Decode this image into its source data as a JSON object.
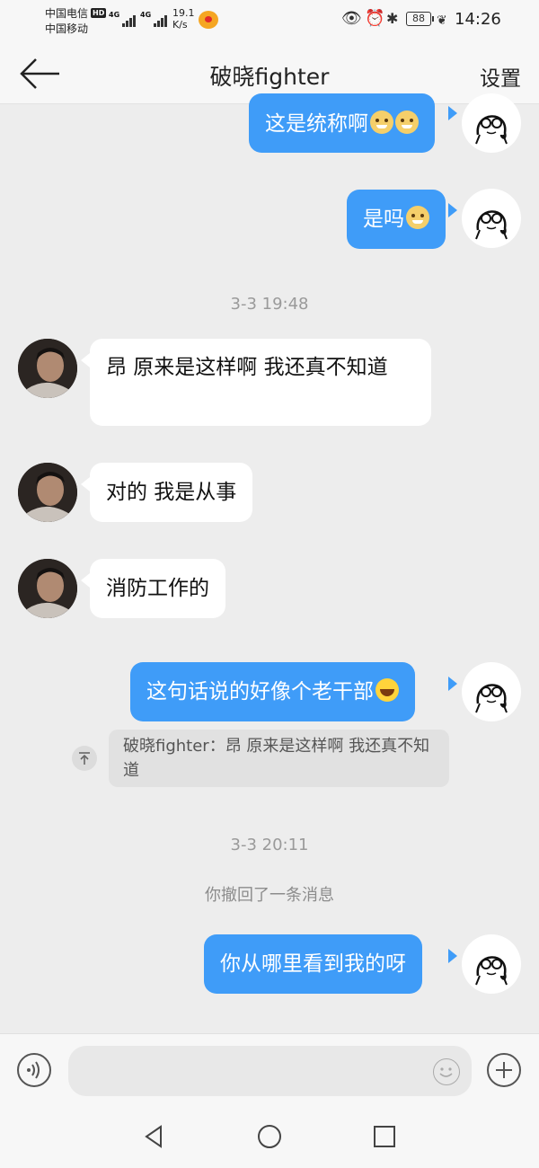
{
  "status_bar": {
    "carrier_1": "中国电信",
    "carrier_1_badge": "HD",
    "carrier_2": "中国移动",
    "network_1": "4G",
    "network_2": "4G",
    "speed_value": "19.1",
    "speed_unit": "K/s",
    "battery": "88",
    "time": "14:26"
  },
  "header": {
    "title": "破晓fighter",
    "settings_label": "设置"
  },
  "messages": [
    {
      "text": "这是统称啊",
      "emoji": [
        "doge-icon",
        "doge-icon"
      ]
    },
    {
      "text": "是吗",
      "emoji": [
        "doge-icon"
      ]
    },
    {
      "timestamp": "3-3 19:48"
    },
    {
      "text": "昂 原来是这样啊 我还真不知道"
    },
    {
      "text": "对的 我是从事"
    },
    {
      "text": "消防工作的"
    },
    {
      "text": "这句话说的好像个老干部",
      "emoji": [
        "laugh-icon"
      ]
    },
    {
      "quote": "破晓fighter：昂 原来是这样啊 我还真不知道"
    },
    {
      "timestamp": "3-3 20:11"
    },
    {
      "system": "你撤回了一条消息"
    },
    {
      "text": "你从哪里看到我的呀"
    }
  ],
  "colors": {
    "outgoing_bubble": "#3f9cf8",
    "incoming_bubble": "#ffffff",
    "background": "#ededed"
  }
}
